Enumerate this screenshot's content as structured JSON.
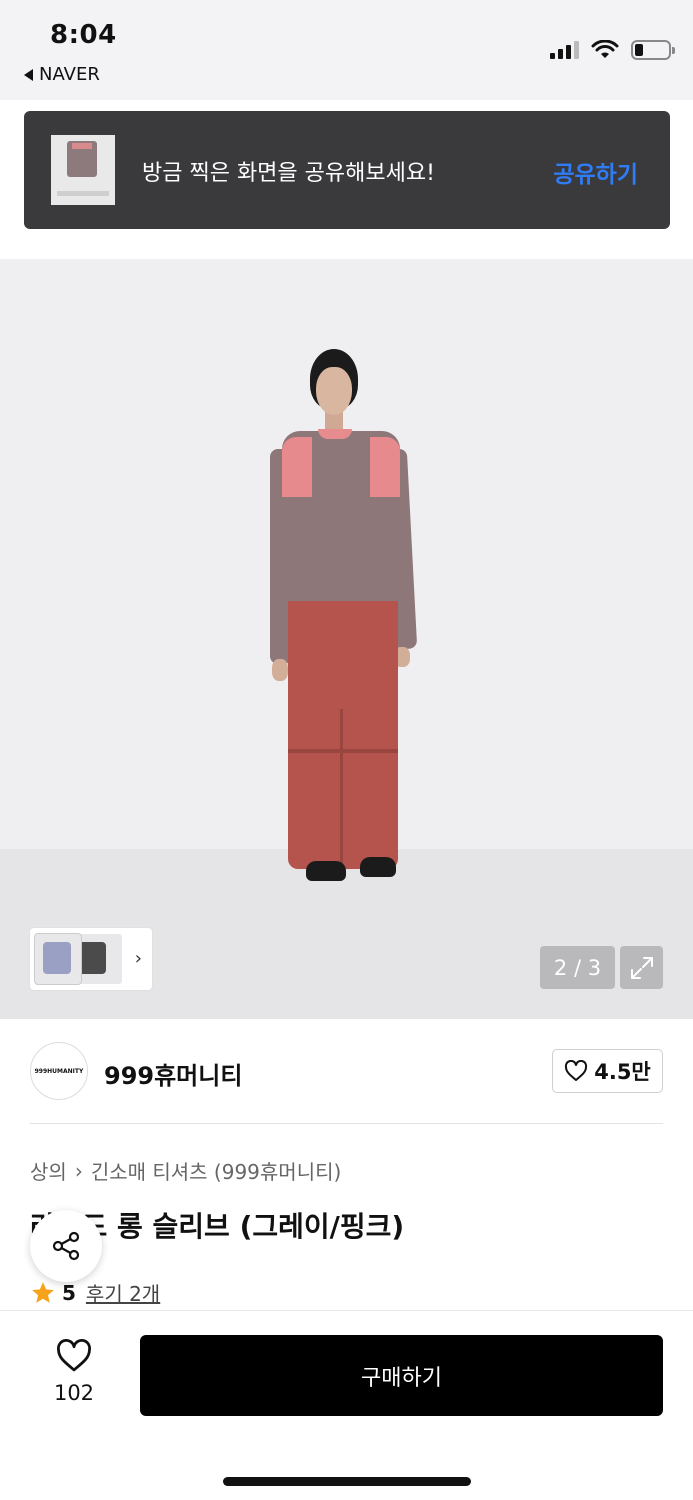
{
  "status_bar": {
    "time": "8:04",
    "back_app": "NAVER"
  },
  "toast": {
    "message": "방금 찍은 화면을 공유해보세요!",
    "action": "공유하기",
    "action_color": "#2f7cf6"
  },
  "gallery": {
    "counter": "2 / 3",
    "expand_icon": "expand-icon"
  },
  "brand": {
    "logo_text": "999HUMANITY",
    "name": "999휴머니티",
    "likes": "4.5만"
  },
  "product": {
    "breadcrumb": [
      "상의",
      "긴소매 티셔츠 (999휴머니티)"
    ],
    "title": "라운드 롱 슬리브 (그레이/핑크)",
    "rating": "5",
    "reviews": "후기 2개"
  },
  "bottom_bar": {
    "wish_count": "102",
    "buy_label": "구매하기"
  }
}
